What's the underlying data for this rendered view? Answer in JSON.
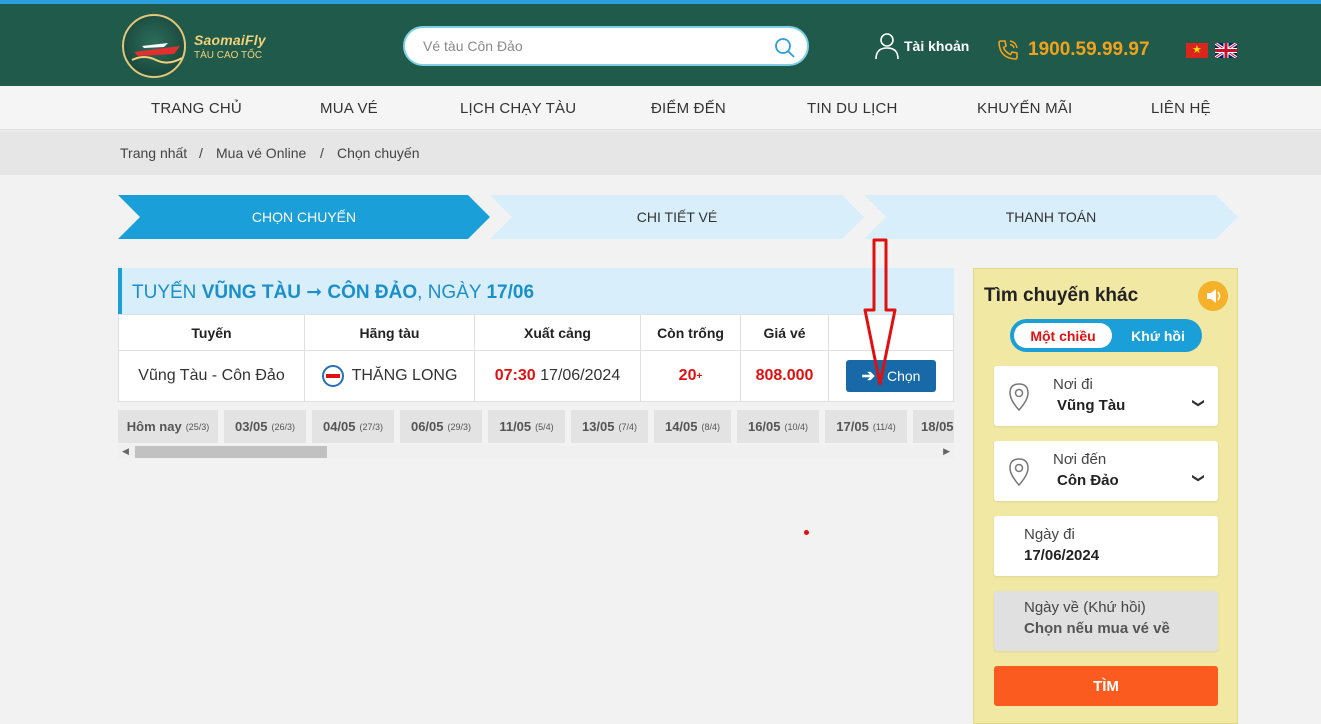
{
  "header": {
    "brand": "SaomaiFly",
    "brand_sub": "TÀU CAO TỐC",
    "search_placeholder": "Vé tàu Côn Đảo",
    "account_label": "Tài khoản",
    "hotline": "1900.59.99.97",
    "flag_vn_icon": "flag-vietnam-icon",
    "flag_uk_icon": "flag-uk-icon"
  },
  "nav": {
    "items": [
      "TRANG CHỦ",
      "MUA VÉ",
      "LỊCH CHẠY TÀU",
      "ĐIỂM ĐẾN",
      "TIN DU LỊCH",
      "KHUYẾN MÃI",
      "LIÊN HỆ"
    ]
  },
  "breadcrumb": {
    "items": [
      "Trang nhất",
      "/",
      "Mua vé Online",
      "/",
      "Chọn chuyến"
    ]
  },
  "steps": [
    "CHỌN CHUYẾN",
    "CHI TIẾT VÉ",
    "THANH TOÁN"
  ],
  "route": {
    "prefix": "TUYẾN ",
    "from": "VŨNG TÀU",
    "arrow": " ➞ ",
    "to": "CÔN ĐẢO",
    "date_prefix": ", NGÀY ",
    "date": "17/06"
  },
  "table": {
    "headers": [
      "Tuyến",
      "Hãng tàu",
      "Xuất cảng",
      "Còn trống",
      "Giá vé",
      ""
    ],
    "row": {
      "route": "Vũng Tàu - Côn Đảo",
      "operator": "THĂNG LONG",
      "depart_time": "07:30",
      "depart_date": "17/06/2024",
      "seats": "20",
      "seats_sup": "+",
      "price": "808.000",
      "choose_label": "Chọn"
    }
  },
  "dates": [
    {
      "label": "Hôm nay",
      "lunar": "(25/3)"
    },
    {
      "label": "03/05",
      "lunar": "(26/3)"
    },
    {
      "label": "04/05",
      "lunar": "(27/3)"
    },
    {
      "label": "06/05",
      "lunar": "(29/3)"
    },
    {
      "label": "11/05",
      "lunar": "(5/4)"
    },
    {
      "label": "13/05",
      "lunar": "(7/4)"
    },
    {
      "label": "14/05",
      "lunar": "(8/4)"
    },
    {
      "label": "16/05",
      "lunar": "(10/4)"
    },
    {
      "label": "17/05",
      "lunar": "(11/4)"
    },
    {
      "label": "18/05",
      "lunar": ""
    }
  ],
  "side": {
    "title": "Tìm chuyến khác",
    "one_way": "Một chiều",
    "round_trip": "Khứ hồi",
    "from_label": "Nơi đi",
    "from_value": "Vũng Tàu",
    "to_label": "Nơi đến",
    "to_value": "Côn Đảo",
    "depart_label": "Ngày đi",
    "depart_value": "17/06/2024",
    "return_label": "Ngày về (Khứ hồi)",
    "return_value": "Chọn nếu mua vé về",
    "search_label": "TÌM"
  },
  "colors": {
    "header_bg": "#1f5a4a",
    "accent_blue": "#1a9fd9",
    "price_red": "#e01010",
    "hotline_orange": "#f0a21b",
    "search_button": "#fb5b1f",
    "side_panel": "#f1e8a3"
  }
}
